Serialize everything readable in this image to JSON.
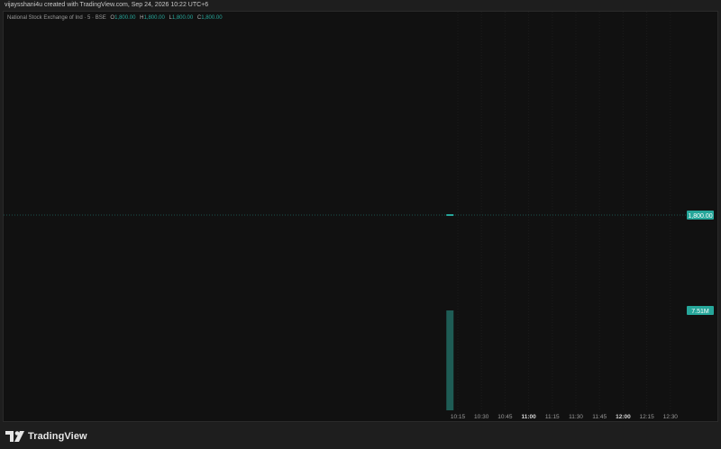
{
  "header": {
    "caption": "vijaysshani4u created with TradingView.com, Sep 24, 2026 10:22 UTC+6"
  },
  "legend": {
    "symbol": "National Stock Exchange of Ind · 5 · BSE",
    "o_label": "O",
    "o_value": "1,800.00",
    "h_label": "H",
    "h_value": "1,800.00",
    "l_label": "L",
    "l_value": "1,800.00",
    "c_label": "C",
    "c_value": "1,800.00"
  },
  "footer": {
    "brand": "TradingView"
  },
  "colors": {
    "background": "#111111",
    "accent": "#26a69a",
    "volume": "#1e5c55",
    "grid": "#1c1c1c"
  },
  "chart_data": {
    "type": "bar",
    "title": "National Stock Exchange of Ind · 5 · BSE",
    "x": [
      "10:15",
      "10:30",
      "10:45",
      "11:00",
      "11:15",
      "11:30",
      "11:45",
      "12:00",
      "12:15",
      "12:30"
    ],
    "x_bold": [
      "11:00",
      "12:00"
    ],
    "price": {
      "open": 1800.0,
      "high": 1800.0,
      "low": 1800.0,
      "close": 1800.0,
      "time": "10:10",
      "label": "1,800.00"
    },
    "volume": {
      "value": 7510000,
      "time": "10:10",
      "label": "7.51M"
    },
    "grid": true
  }
}
